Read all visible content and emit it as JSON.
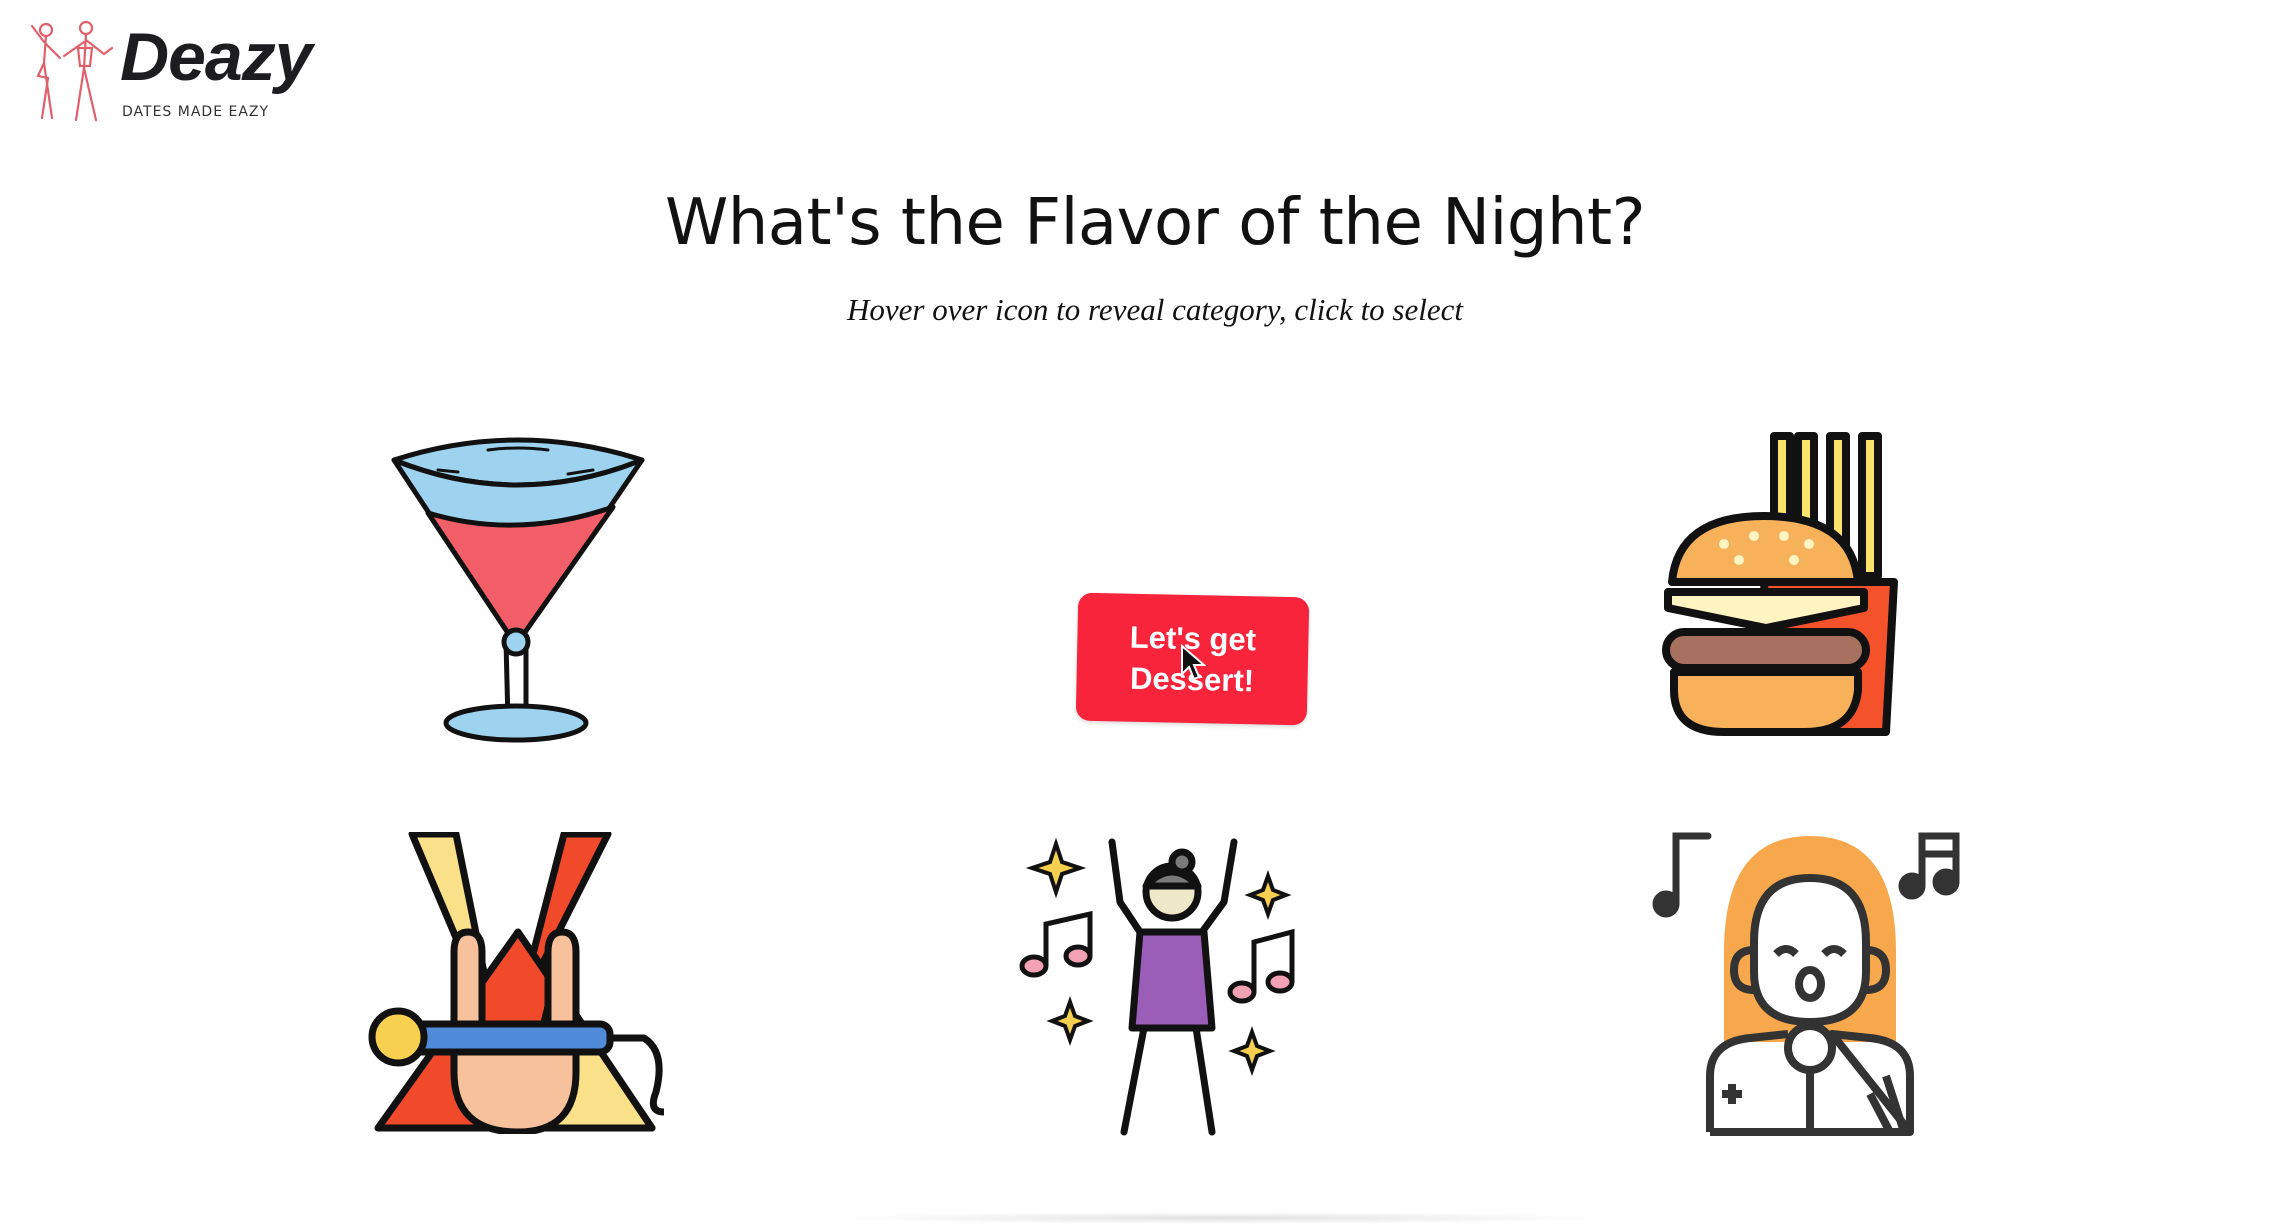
{
  "brand": {
    "name": "Deazy",
    "tagline": "DATES MADE EAZY",
    "accent": "#f7243c"
  },
  "heading": {
    "title": "What's the Flavor of the Night?",
    "subtitle": "Hover over icon to reveal category, click to select"
  },
  "categories": [
    {
      "icon": "cocktail-glass-icon"
    },
    {
      "icon": "dessert-button",
      "label": "Let's get\nDessert!"
    },
    {
      "icon": "burger-fries-icon"
    },
    {
      "icon": "rock-concert-icon"
    },
    {
      "icon": "dancing-party-icon"
    },
    {
      "icon": "karaoke-singer-icon"
    }
  ]
}
